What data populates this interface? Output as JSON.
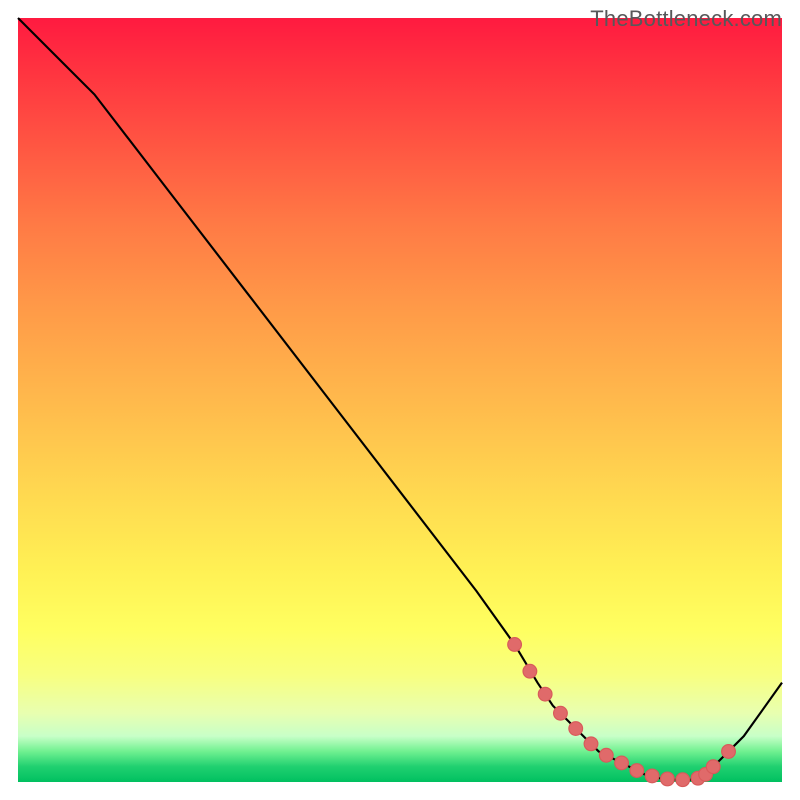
{
  "attribution": "TheBottleneck.com",
  "colors": {
    "curve_stroke": "#000000",
    "marker_fill": "#e06a6a",
    "marker_stroke": "#d85a5a"
  },
  "chart_data": {
    "type": "line",
    "title": "",
    "xlabel": "",
    "ylabel": "",
    "xlim": [
      0,
      100
    ],
    "ylim": [
      0,
      100
    ],
    "x": [
      0,
      6,
      10,
      20,
      30,
      40,
      50,
      60,
      65,
      68,
      70,
      72,
      74,
      76,
      78,
      80,
      82,
      84,
      86,
      88,
      89,
      90,
      91,
      93,
      95,
      100
    ],
    "y": [
      100,
      94,
      90,
      77,
      64,
      51,
      38,
      25,
      18,
      13,
      10,
      8,
      6,
      4,
      3,
      2,
      1,
      0.5,
      0.3,
      0.3,
      0.5,
      1,
      2,
      4,
      6,
      13
    ],
    "markers": {
      "x": [
        65,
        67,
        69,
        71,
        73,
        75,
        77,
        79,
        81,
        83,
        85,
        87,
        89,
        90,
        91,
        93
      ],
      "y": [
        18,
        14.5,
        11.5,
        9,
        7,
        5,
        3.5,
        2.5,
        1.5,
        0.8,
        0.4,
        0.3,
        0.5,
        1,
        2,
        4
      ]
    }
  }
}
